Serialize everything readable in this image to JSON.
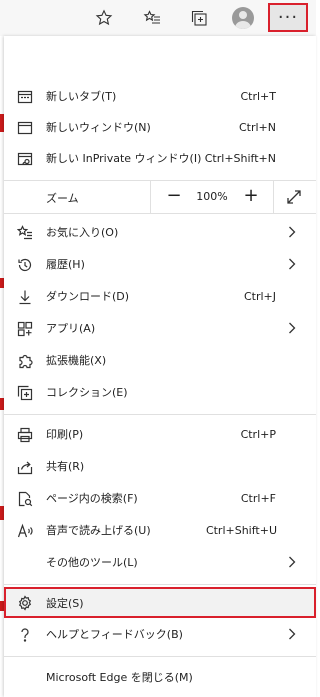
{
  "toolbar": {
    "more_label": "···"
  },
  "menu": {
    "new_tab": {
      "label": "新しいタブ(T)",
      "shortcut": "Ctrl+T"
    },
    "new_window": {
      "label": "新しいウィンドウ(N)",
      "shortcut": "Ctrl+N"
    },
    "new_inprivate": {
      "label": "新しい InPrivate ウィンドウ(I)",
      "shortcut": "Ctrl+Shift+N"
    },
    "zoom": {
      "label": "ズーム",
      "minus": "−",
      "value": "100%",
      "plus": "+"
    },
    "favorites": {
      "label": "お気に入り(O)"
    },
    "history": {
      "label": "履歴(H)"
    },
    "downloads": {
      "label": "ダウンロード(D)",
      "shortcut": "Ctrl+J"
    },
    "apps": {
      "label": "アプリ(A)"
    },
    "extensions": {
      "label": "拡張機能(X)"
    },
    "collections": {
      "label": "コレクション(E)"
    },
    "print": {
      "label": "印刷(P)",
      "shortcut": "Ctrl+P"
    },
    "share": {
      "label": "共有(R)"
    },
    "find": {
      "label": "ページ内の検索(F)",
      "shortcut": "Ctrl+F"
    },
    "read_aloud": {
      "label": "音声で読み上げる(U)",
      "shortcut": "Ctrl+Shift+U"
    },
    "more_tools": {
      "label": "その他のツール(L)"
    },
    "settings": {
      "label": "設定(S)"
    },
    "help": {
      "label": "ヘルプとフィードバック(B)"
    },
    "close": {
      "label": "Microsoft Edge を閉じる(M)"
    }
  },
  "colors": {
    "highlight_border": "#d9202c",
    "page_accent": "#cc1b1b"
  }
}
